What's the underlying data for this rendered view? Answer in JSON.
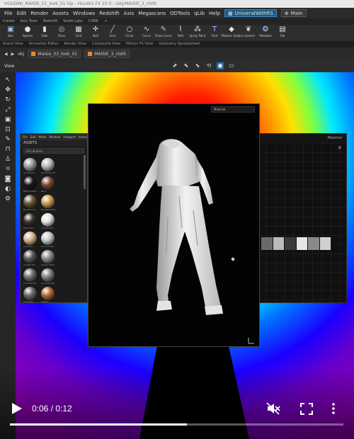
{
  "window": {
    "title": "HOUDINI_MAISIE_01_look_01.hip - Houdini FX 20.0 - /obj/MAISIE_3_cloth"
  },
  "menubar": {
    "items": [
      "File",
      "Edit",
      "Render",
      "Assets",
      "Windows",
      "Redshift",
      "Axis",
      "Megascans",
      "ODTools",
      "qLib",
      "Help"
    ],
    "desktop": "UniveralWithRS",
    "desktop_main": "Main"
  },
  "shelf_tabs": [
    "Create",
    "Axis Tools",
    "Redshift",
    "Seleft Labs",
    "CHNK"
  ],
  "shelf_tools": [
    {
      "label": "Box",
      "icon": "box-icon",
      "glyph": "▣"
    },
    {
      "label": "Sphere",
      "icon": "sphere-icon",
      "glyph": "●"
    },
    {
      "label": "Tube",
      "icon": "tube-icon",
      "glyph": "▮"
    },
    {
      "label": "Torus",
      "icon": "torus-icon",
      "glyph": "◎"
    },
    {
      "label": "Grid",
      "icon": "grid-icon",
      "glyph": "▦"
    },
    {
      "label": "Null",
      "icon": "null-icon",
      "glyph": "✛"
    },
    {
      "label": "Line",
      "icon": "line-icon",
      "glyph": "╱"
    },
    {
      "label": "Circle",
      "icon": "circle-icon",
      "glyph": "○"
    },
    {
      "label": "Curve",
      "icon": "curve-icon",
      "glyph": "∿"
    },
    {
      "label": "Draw Curve",
      "icon": "draw-curve-icon",
      "glyph": "✎"
    },
    {
      "label": "Path",
      "icon": "path-icon",
      "glyph": "⌇"
    },
    {
      "label": "Spray Paint",
      "icon": "spray-paint-icon",
      "glyph": "⁂"
    },
    {
      "label": "Font",
      "icon": "font-icon",
      "glyph": "T"
    },
    {
      "label": "Platonic Solids",
      "icon": "platonic-icon",
      "glyph": "◆"
    },
    {
      "label": "L-System",
      "icon": "lsystem-icon",
      "glyph": "❦"
    },
    {
      "label": "Metaball",
      "icon": "metaball-icon",
      "glyph": "❂"
    },
    {
      "label": "File",
      "icon": "file-icon",
      "glyph": "▤"
    }
  ],
  "pane_tabs": [
    "Scene View",
    "Animation Editor",
    "Render View",
    "Composite View",
    "Motion FX View",
    "Geometry Spreadsheet"
  ],
  "path": {
    "root": "obj",
    "chip1": "Maisie_03_look_01",
    "chip2": "MAISIE_3_cloth"
  },
  "viewbar": {
    "label": "View"
  },
  "asset_browser": {
    "menu": [
      "File",
      "Edit",
      "Mode",
      "Window",
      "Viewport",
      "Action"
    ],
    "title": "ASSETS",
    "filter": "All Libraries",
    "swatches": [
      {
        "label": "Aluminium",
        "color": "#9a9a9a"
      },
      {
        "label": "Aluminium Br",
        "color": "#b8b8b8"
      },
      {
        "label": "Black Plastic",
        "color": "#1a1a1a"
      },
      {
        "label": "Brick",
        "color": "#7a4a36"
      },
      {
        "label": "Brushed Cu",
        "color": "#6b5a3c"
      },
      {
        "label": "Brushed Gold",
        "color": "#c8a050"
      },
      {
        "label": "Burnt Gra",
        "color": "#3a342c"
      },
      {
        "label": "Ceramic Pla",
        "color": "#e8e4dc"
      },
      {
        "label": "Cloth Bur",
        "color": "#d6b48a"
      },
      {
        "label": "Coconut Pla",
        "color": "#c9c9c9"
      },
      {
        "label": "Cooked Art",
        "color": "#5a5a5a"
      },
      {
        "label": "Copper Patin",
        "color": "#8c8c8c"
      },
      {
        "label": "Concrete Ro",
        "color": "#707070"
      },
      {
        "label": "Concrete Wa",
        "color": "#808080"
      },
      {
        "label": "Concrete",
        "color": "#6a6a6a"
      },
      {
        "label": "Copper",
        "color": "#b26a3a"
      }
    ]
  },
  "render_window": {
    "dropdown": "Material"
  },
  "node_editor": {
    "title": "Material"
  },
  "player": {
    "current_time": "0:06",
    "separator": " / ",
    "duration": "0:12",
    "progress": 0.53,
    "muted": true
  },
  "colors": {
    "accent": "#2a6aa0",
    "progress_fill": "#ffffff"
  }
}
